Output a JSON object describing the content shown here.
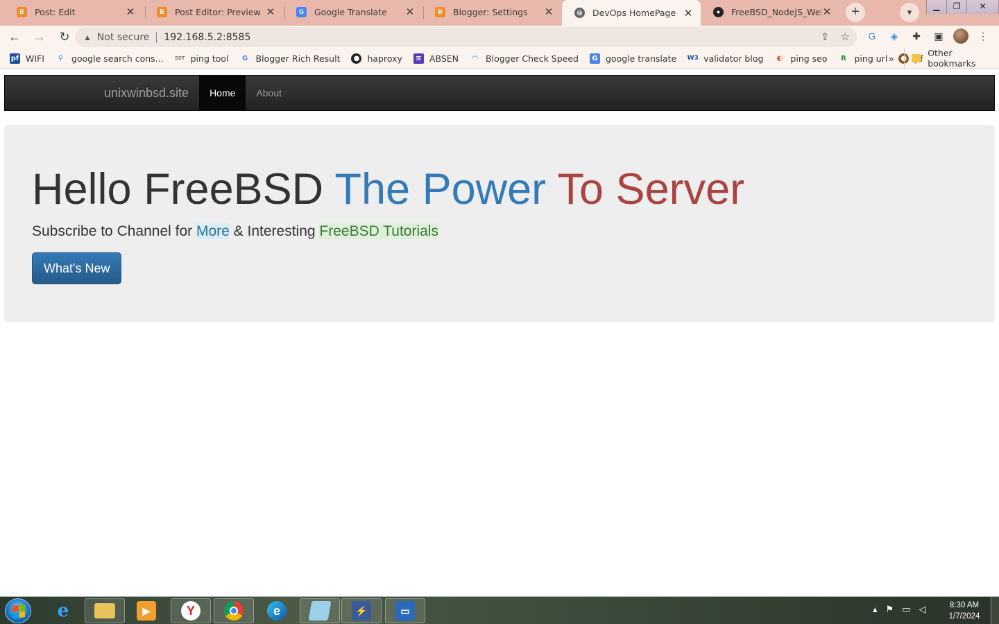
{
  "browser": {
    "tabs": [
      {
        "title": "Post: Edit",
        "icon": "blogger-icon",
        "active": false
      },
      {
        "title": "Post Editor: Preview",
        "icon": "blogger-icon",
        "active": false
      },
      {
        "title": "Google Translate",
        "icon": "google-translate-icon",
        "active": false
      },
      {
        "title": "Blogger: Settings",
        "icon": "blogger-icon",
        "active": false
      },
      {
        "title": "DevOps HomePage",
        "icon": "globe-icon",
        "active": true
      },
      {
        "title": "FreeBSD_NodeJS_WebApp",
        "icon": "github-icon",
        "active": false
      }
    ],
    "new_tab_label": "+",
    "security_label": "Not secure",
    "url": "192.168.5.2:8585",
    "bookmarks": [
      {
        "label": "WIFI",
        "icon": "pfsense-icon"
      },
      {
        "label": "google search cons...",
        "icon": "search-console-icon"
      },
      {
        "label": "ping tool",
        "icon": "sst-icon"
      },
      {
        "label": "Blogger Rich Result",
        "icon": "google-icon"
      },
      {
        "label": "haproxy",
        "icon": "github-icon"
      },
      {
        "label": "ABSEN",
        "icon": "list-icon"
      },
      {
        "label": "Blogger Check Speed",
        "icon": "speed-icon"
      },
      {
        "label": "google translate",
        "icon": "google-translate-icon"
      },
      {
        "label": "validator blog",
        "icon": "w3c-icon"
      },
      {
        "label": "ping seo",
        "icon": "rocket-icon"
      },
      {
        "label": "ping url",
        "icon": "ping-url-icon"
      },
      {
        "label": "pf",
        "icon": "pf-icon"
      }
    ],
    "bookmarks_overflow": "»",
    "other_bookmarks": "Other bookmarks"
  },
  "page": {
    "navbar": {
      "brand": "unixwinbsd.site",
      "items": [
        {
          "label": "Home",
          "active": true
        },
        {
          "label": "About",
          "active": false
        }
      ]
    },
    "jumbotron": {
      "title_part1": "Hello FreeBSD ",
      "title_part2": "The Power ",
      "title_part3": "To Server",
      "subtitle_part1": "Subscribe to Channel for ",
      "subtitle_part2": "More",
      "subtitle_part3": " & Interesting ",
      "subtitle_part4": "FreeBSD Tutorials",
      "button_label": "What's New"
    }
  },
  "taskbar": {
    "time": "8:30 AM",
    "date": "1/7/2024"
  },
  "colors": {
    "tabstrip": "#e9b8ad",
    "navbar": "#222222",
    "jumbotron": "#eeeeee",
    "title_blue": "#337ab7",
    "title_red": "#a94442",
    "button": "#337ab7"
  }
}
